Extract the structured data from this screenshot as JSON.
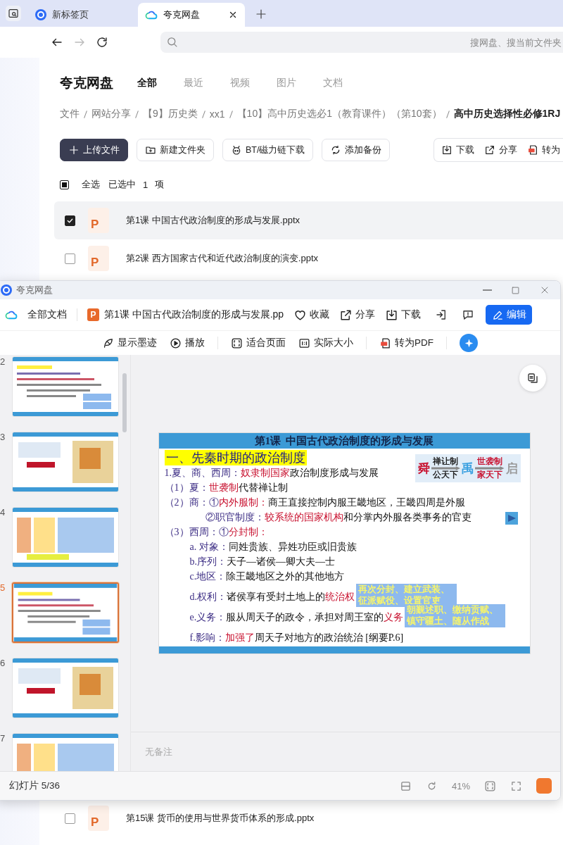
{
  "browser": {
    "tabs": [
      {
        "label": "新标签页",
        "selected": false
      },
      {
        "label": "夸克网盘",
        "selected": true
      }
    ],
    "search": {
      "placeholder": "搜网盘、搜当前文件夹"
    }
  },
  "app": {
    "logo": "夸克网盘",
    "nav": [
      {
        "label": "全部",
        "selected": true
      },
      {
        "label": "最近",
        "selected": false
      },
      {
        "label": "视频",
        "selected": false
      },
      {
        "label": "图片",
        "selected": false
      },
      {
        "label": "文档",
        "selected": false
      }
    ],
    "breadcrumb": [
      "文件",
      "网站分享",
      "【9】历史类",
      "xx1",
      "【10】高中历史选必1（教育课件）（第10套）",
      "高中历史选择性必修1RJ"
    ],
    "toolbar": [
      {
        "label": "上传文件",
        "kind": "primary"
      },
      {
        "label": "新建文件夹",
        "kind": "folder"
      },
      {
        "label": "BT/磁力链下载",
        "kind": "bt"
      },
      {
        "label": "添加备份",
        "kind": "backup"
      }
    ],
    "actions": [
      {
        "label": "下载",
        "kind": "download"
      },
      {
        "label": "分享",
        "kind": "share"
      },
      {
        "label": "转为",
        "kind": "pdf"
      }
    ],
    "selection": {
      "indeterminate": true,
      "label": "全选",
      "status": "已选中",
      "count": "1",
      "unit": "项"
    },
    "files": [
      {
        "name": "第1课 中国古代政治制度的形成与发展.pptx",
        "icon": "P",
        "checked": true,
        "selected": true
      },
      {
        "name": "第2课 西方国家古代和近代政治制度的演变.pptx",
        "icon": "P",
        "checked": false,
        "selected": false
      },
      {
        "name": "第15课 货币的使用与世界货币体系的形成.pptx",
        "icon": "P",
        "checked": false,
        "selected": false
      }
    ]
  },
  "viewer": {
    "title": "夸克网盘",
    "all_docs": "全部文档",
    "file": {
      "icon": "P",
      "name": "第1课 中国古代政治制度的形成与发展.pp"
    },
    "actions": [
      {
        "label": "收藏",
        "kind": "favorite"
      },
      {
        "label": "分享",
        "kind": "share"
      },
      {
        "label": "下载",
        "kind": "download"
      }
    ],
    "edit": "编辑",
    "tools": [
      {
        "label": "显示墨迹",
        "kind": "ink"
      },
      {
        "label": "播放",
        "kind": "play"
      },
      {
        "label": "适合页面",
        "kind": "fit"
      },
      {
        "label": "实际大小",
        "kind": "actual"
      },
      {
        "label": "转为PDF",
        "kind": "pdf"
      }
    ],
    "thumbnails": [
      {
        "number": "2",
        "selected": false
      },
      {
        "number": "3",
        "selected": false
      },
      {
        "number": "4",
        "selected": false
      },
      {
        "number": "5",
        "selected": true
      },
      {
        "number": "6",
        "selected": false
      },
      {
        "number": "7",
        "selected": false
      }
    ],
    "slide": {
      "header": "第1课  中国古代政治制度的形成与发展",
      "heading": "一、先秦时期的政治制度",
      "diagram": [
        {
          "kind": "node",
          "text": "舜",
          "color": "#c8102e"
        },
        {
          "kind": "arrow",
          "above": "禅让制",
          "below": "公天下",
          "color": "#222222"
        },
        {
          "kind": "node",
          "text": "禹",
          "color": "#3aa0e0"
        },
        {
          "kind": "arrow",
          "above": "世袭制",
          "below": "家天下",
          "color": "#c8102e"
        },
        {
          "kind": "node",
          "text": "启",
          "color": "#9a9a9a"
        }
      ],
      "lines": [
        {
          "kind": "line",
          "segments": [
            {
              "kind": "label",
              "text": "1.夏、商、西周："
            },
            {
              "kind": "term",
              "text": "奴隶制国家"
            },
            {
              "kind": "text",
              "text": "政治制度形成与发展"
            }
          ]
        },
        {
          "kind": "line",
          "segments": [
            {
              "kind": "label",
              "text": "（1）夏："
            },
            {
              "kind": "term",
              "text": "世袭制"
            },
            {
              "kind": "text",
              "text": "代替禅让制"
            }
          ]
        },
        {
          "kind": "line",
          "segments": [
            {
              "kind": "label",
              "text": "（2）商：①"
            },
            {
              "kind": "term",
              "text": "内外服制："
            },
            {
              "kind": "text",
              "text": "商王直接控制内服王畿地区，王畿四周是外服"
            }
          ]
        },
        {
          "kind": "continuation",
          "segments": [
            {
              "kind": "label",
              "text": "②职官制度："
            },
            {
              "kind": "term",
              "text": "较系统的国家机构"
            },
            {
              "kind": "text",
              "text": "和分掌内外服各类事务的官吏"
            }
          ]
        },
        {
          "kind": "line",
          "segments": [
            {
              "kind": "label",
              "text": "（3）西周：①"
            },
            {
              "kind": "term",
              "text": "分封制："
            }
          ],
          "children": [
            {
              "kind": "line",
              "segments": [
                {
                  "kind": "label",
                  "text": "a. 对象："
                },
                {
                  "kind": "text",
                  "text": "同姓贵族、异姓功臣或旧贵族"
                }
              ]
            },
            {
              "kind": "line",
              "segments": [
                {
                  "kind": "label",
                  "text": "b.序列："
                },
                {
                  "kind": "text",
                  "text": "天子—诸侯—卿大夫—士"
                }
              ]
            },
            {
              "kind": "line",
              "segments": [
                {
                  "kind": "label",
                  "text": "c.地区："
                },
                {
                  "kind": "text",
                  "text": "除王畿地区之外的其他地方"
                }
              ]
            },
            {
              "kind": "line",
              "segments": [
                {
                  "kind": "label",
                  "text": "d.权利："
                },
                {
                  "kind": "text",
                  "text": "诸侯享有受封土地上的"
                },
                {
                  "kind": "term",
                  "text": "统治权"
                }
              ],
              "note": "再次分封、建立武装、征派赋役、设置官吏"
            },
            {
              "kind": "line",
              "segments": [
                {
                  "kind": "label",
                  "text": "e.义务："
                },
                {
                  "kind": "text",
                  "text": "服从周天子的政令，承担对周王室的"
                },
                {
                  "kind": "term",
                  "text": "义务"
                }
              ],
              "note": "朝觐述职、缴纳贡赋、镇守疆土、随从作战"
            },
            {
              "kind": "line",
              "segments": [
                {
                  "kind": "label",
                  "text": "f.影响："
                },
                {
                  "kind": "term",
                  "text": "加强了"
                },
                {
                  "kind": "text",
                  "text": "周天子对地方的政治统治 [纲要P.6]"
                }
              ]
            }
          ]
        }
      ]
    },
    "notes": {
      "placeholder": "无备注"
    },
    "status": "幻灯片 5/36",
    "zoom": "41%"
  }
}
